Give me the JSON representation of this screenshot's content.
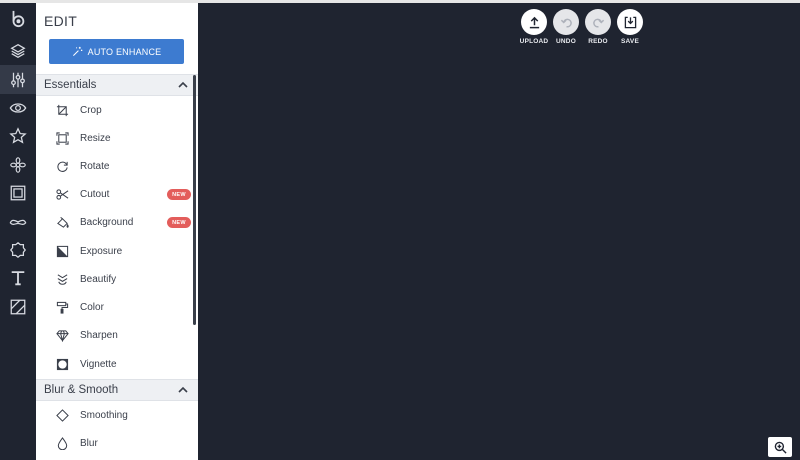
{
  "panel": {
    "title": "EDIT",
    "auto_enhance_label": "AUTO ENHANCE"
  },
  "sections": {
    "essentials": {
      "title": "Essentials",
      "items": [
        {
          "label": "Crop",
          "icon": "crop-icon"
        },
        {
          "label": "Resize",
          "icon": "resize-icon"
        },
        {
          "label": "Rotate",
          "icon": "rotate-icon"
        },
        {
          "label": "Cutout",
          "icon": "scissors-icon",
          "badge": "NEW"
        },
        {
          "label": "Background",
          "icon": "paint-bucket-icon",
          "badge": "NEW"
        },
        {
          "label": "Exposure",
          "icon": "exposure-icon"
        },
        {
          "label": "Beautify",
          "icon": "beautify-icon"
        },
        {
          "label": "Color",
          "icon": "paint-roller-icon"
        },
        {
          "label": "Sharpen",
          "icon": "diamond-icon"
        },
        {
          "label": "Vignette",
          "icon": "vignette-icon"
        }
      ]
    },
    "blur_smooth": {
      "title": "Blur & Smooth",
      "items": [
        {
          "label": "Smoothing",
          "icon": "smoothing-icon"
        },
        {
          "label": "Blur",
          "icon": "droplet-icon"
        }
      ]
    }
  },
  "toolbar": {
    "upload": "UPLOAD",
    "undo": "UNDO",
    "redo": "REDO",
    "save": "SAVE"
  },
  "colors": {
    "canvas": "#1f2430",
    "accent": "#3d7bd0",
    "badge": "#e35d5b"
  }
}
